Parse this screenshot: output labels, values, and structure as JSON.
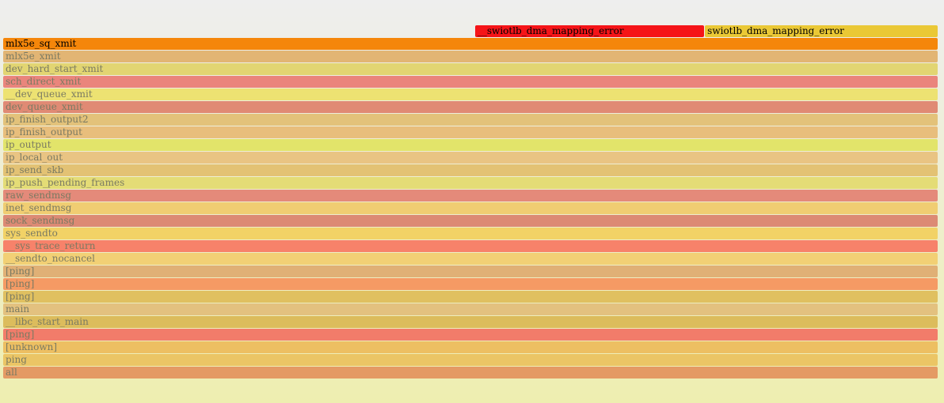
{
  "flamegraph": {
    "frames": [
      {
        "name": "__swiotlb_dma_mapping_error",
        "depth": 27,
        "start": 0.505,
        "width": 0.245,
        "color": "#f51418",
        "emphasis": true
      },
      {
        "name": "swiotlb_dma_mapping_error",
        "depth": 27,
        "start": 0.751,
        "width": 0.249,
        "color": "#eac835",
        "emphasis": true
      },
      {
        "name": "mlx5e_sq_xmit",
        "depth": 26,
        "start": 0,
        "width": 1,
        "color": "#f5860a",
        "emphasis": true
      },
      {
        "name": "mlx5e_xmit",
        "depth": 25,
        "start": 0,
        "width": 1,
        "color": "#e2b574"
      },
      {
        "name": "dev_hard_start_xmit",
        "depth": 24,
        "start": 0,
        "width": 1,
        "color": "#e2d572"
      },
      {
        "name": "sch_direct_xmit",
        "depth": 23,
        "start": 0,
        "width": 1,
        "color": "#ea857c"
      },
      {
        "name": "__dev_queue_xmit",
        "depth": 22,
        "start": 0,
        "width": 1,
        "color": "#ede272"
      },
      {
        "name": "dev_queue_xmit",
        "depth": 21,
        "start": 0,
        "width": 1,
        "color": "#e08a74"
      },
      {
        "name": "ip_finish_output2",
        "depth": 20,
        "start": 0,
        "width": 1,
        "color": "#e3c27a"
      },
      {
        "name": "ip_finish_output",
        "depth": 19,
        "start": 0,
        "width": 1,
        "color": "#e8be7c"
      },
      {
        "name": "ip_output",
        "depth": 18,
        "start": 0,
        "width": 1,
        "color": "#e2e46a"
      },
      {
        "name": "ip_local_out",
        "depth": 17,
        "start": 0,
        "width": 1,
        "color": "#e9c483"
      },
      {
        "name": "ip_send_skb",
        "depth": 16,
        "start": 0,
        "width": 1,
        "color": "#e3c274"
      },
      {
        "name": "ip_push_pending_frames",
        "depth": 15,
        "start": 0,
        "width": 1,
        "color": "#e4dc76"
      },
      {
        "name": "raw_sendmsg",
        "depth": 14,
        "start": 0,
        "width": 1,
        "color": "#e48a7a"
      },
      {
        "name": "inet_sendmsg",
        "depth": 13,
        "start": 0,
        "width": 1,
        "color": "#f0cd72"
      },
      {
        "name": "sock_sendmsg",
        "depth": 12,
        "start": 0,
        "width": 1,
        "color": "#dc8a74"
      },
      {
        "name": "sys_sendto",
        "depth": 11,
        "start": 0,
        "width": 1,
        "color": "#f2d266"
      },
      {
        "name": "__sys_trace_return",
        "depth": 10,
        "start": 0,
        "width": 1,
        "color": "#f7826a"
      },
      {
        "name": "__sendto_nocancel",
        "depth": 9,
        "start": 0,
        "width": 1,
        "color": "#f2d075"
      },
      {
        "name": "[ping]",
        "depth": 8,
        "start": 0,
        "width": 1,
        "color": "#e0b076"
      },
      {
        "name": "[ping]",
        "depth": 7,
        "start": 0,
        "width": 1,
        "color": "#f59a64"
      },
      {
        "name": "[ping]",
        "depth": 6,
        "start": 0,
        "width": 1,
        "color": "#e0c060"
      },
      {
        "name": "main",
        "depth": 5,
        "start": 0,
        "width": 1,
        "color": "#e3c17f"
      },
      {
        "name": "__libc_start_main",
        "depth": 4,
        "start": 0,
        "width": 1,
        "color": "#dcbc5c"
      },
      {
        "name": "[ping]",
        "depth": 3,
        "start": 0,
        "width": 1,
        "color": "#f27c6a"
      },
      {
        "name": "[unknown]",
        "depth": 2,
        "start": 0,
        "width": 1,
        "color": "#edbf62"
      },
      {
        "name": "ping",
        "depth": 1,
        "start": 0,
        "width": 1,
        "color": "#ebc565"
      },
      {
        "name": "all",
        "depth": 0,
        "start": 0,
        "width": 1,
        "color": "#e49a64"
      }
    ]
  }
}
